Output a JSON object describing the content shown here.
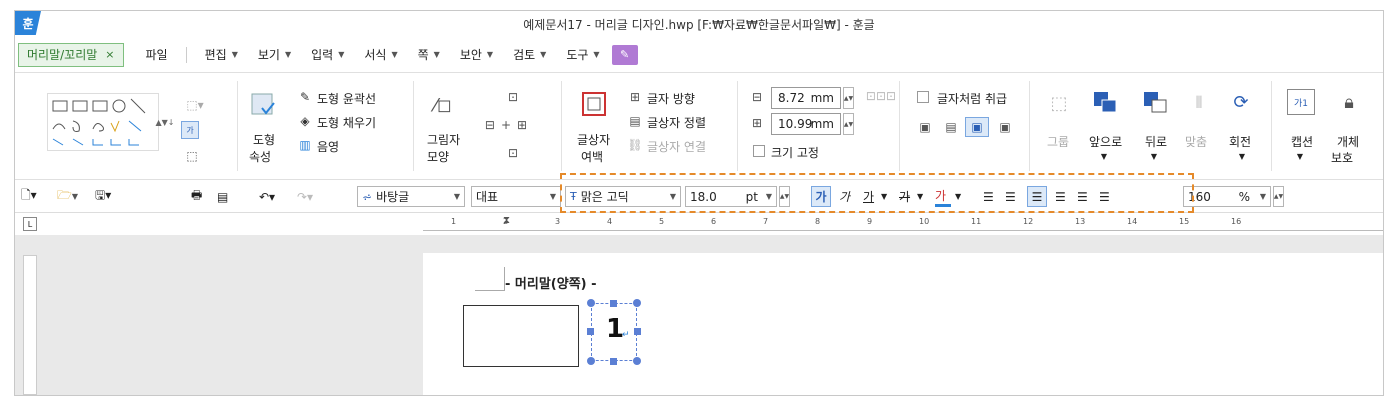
{
  "window": {
    "logo": "훈",
    "title": "예제문서17 - 머리글 디자인.hwp [F:₩자료₩한글문서파일₩] - 훈글"
  },
  "menu": {
    "context_tab": "머리말/꼬리말",
    "context_close": "×",
    "file": "파일",
    "items": [
      "편집",
      "보기",
      "입력",
      "서식",
      "쪽",
      "보안",
      "검토",
      "도구"
    ]
  },
  "ribbon": {
    "shape_props": {
      "line1": "도형",
      "line2": "속성"
    },
    "outline": "도형 윤곽선",
    "fill": "도형 채우기",
    "shadow": "음영",
    "pic_shape": {
      "line1": "그림자",
      "line2": "모양"
    },
    "textbox_margin": {
      "line1": "글상자",
      "line2": "여백"
    },
    "text_direction": "글자 방향",
    "text_align": "글상자 정렬",
    "textbox_link": "글상자 연결",
    "width_value": "8.72",
    "height_value": "10.99",
    "unit": "mm",
    "fix_size": "크기 고정",
    "treat_as_char": "글자처럼 취급",
    "group": "그룹",
    "to_front": "앞으로",
    "to_back": "뒤로",
    "align": "맞춤",
    "rotate": "회전",
    "caption": "캡션",
    "protect": {
      "line1": "개체",
      "line2": "보호"
    }
  },
  "format_bar": {
    "style": "바탕글",
    "lang": "대표",
    "font": "맑은 고딕",
    "size": "18.0",
    "size_unit": "pt",
    "bold": "가",
    "italic": "가",
    "underline": "가",
    "strike": "가",
    "color": "가",
    "zoom": "160",
    "zoom_unit": "%"
  },
  "ruler": {
    "ticks": [
      "1",
      "2",
      "3",
      "4",
      "5",
      "6",
      "7",
      "8",
      "9",
      "10",
      "11",
      "12",
      "13",
      "14",
      "15",
      "16"
    ]
  },
  "document": {
    "header_label": "머리말(양쪽)",
    "page_number": "1"
  },
  "colors": {
    "accent": "#2b83d9",
    "context_green": "#2f7a2f",
    "highlight": "#e58a2a",
    "handle": "#5b7fd4"
  }
}
